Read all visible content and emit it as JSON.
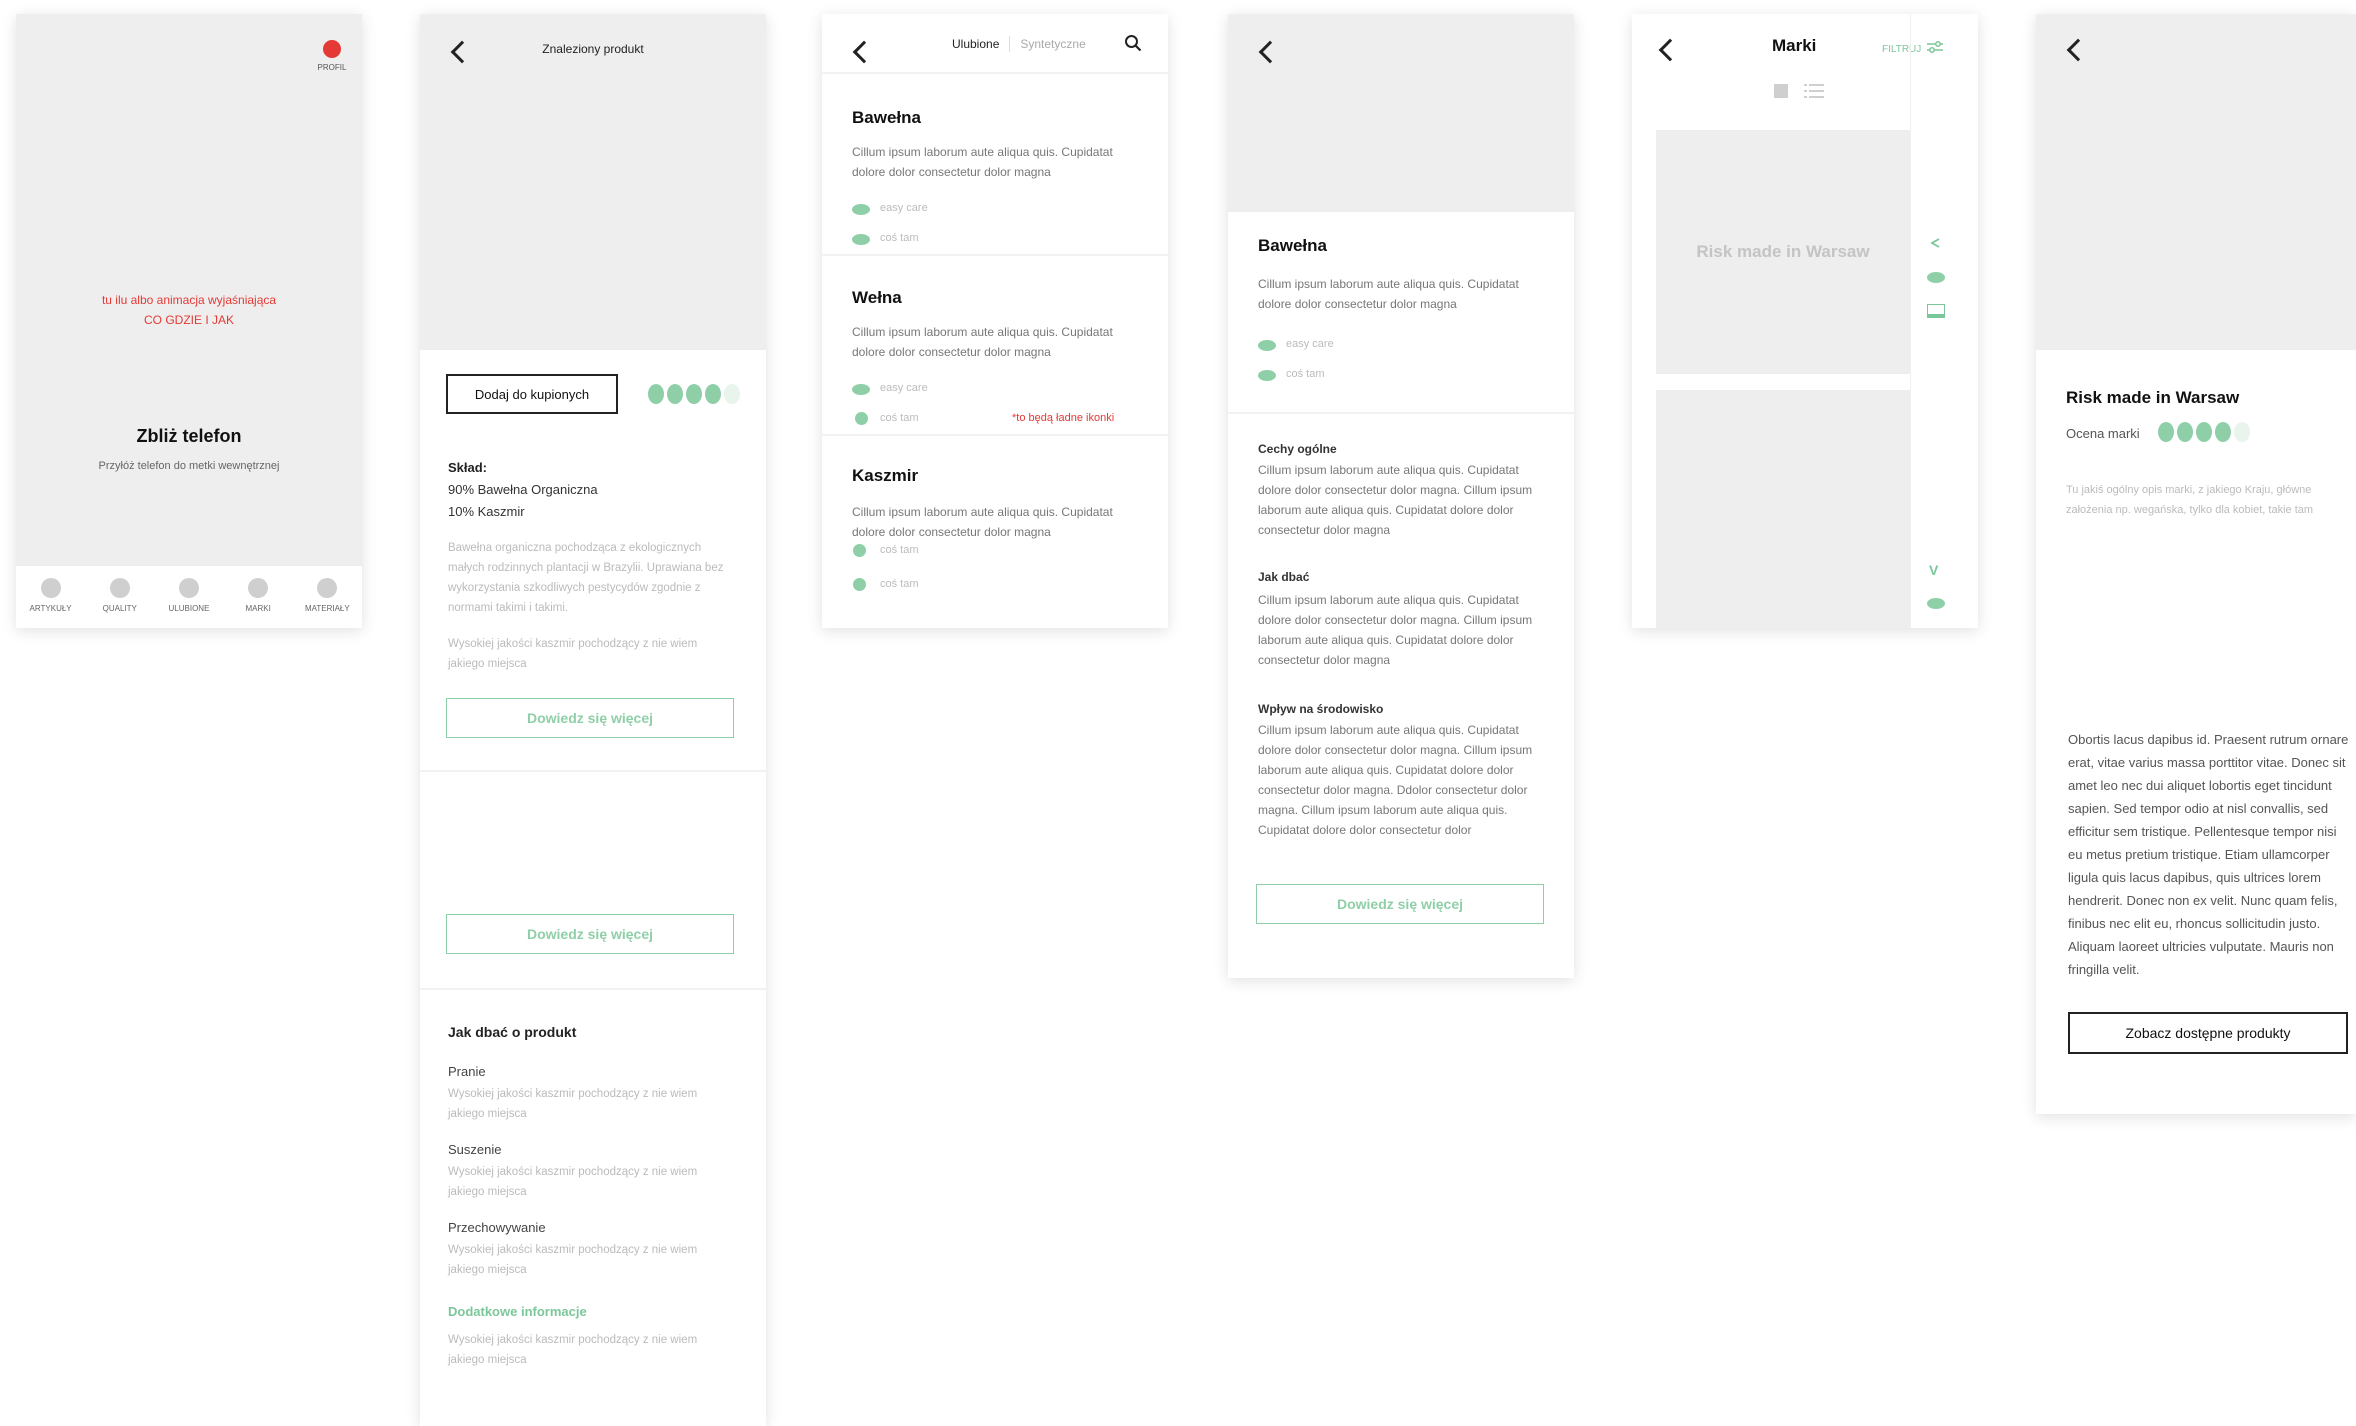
{
  "colors": {
    "accent": "#8fcfa8",
    "red": "#e53935",
    "placeholder": "#eeeeee"
  },
  "s1": {
    "profile_label": "PROFIL",
    "anim_note_1": "tu ilu albo animacja wyjaśniająca",
    "anim_note_2": "CO GDZIE I JAK",
    "title": "Zbliż telefon",
    "subtitle": "Przyłóż telefon do metki wewnętrznej",
    "nav": [
      "ARTYKUŁY",
      "QUALITY",
      "ULUBIONE",
      "MARKI",
      "MATERIAŁY"
    ]
  },
  "s2": {
    "title": "Znaleziony produkt",
    "add_button": "Dodaj do kupionych",
    "rating": 4,
    "sklad_label": "Skład:",
    "sklad_1": "90% Bawełna Organiczna",
    "sklad_2": "10% Kaszmir",
    "desc1": "Bawełna organiczna pochodząca z ekologicznych małych rodzinnych plantacji w Brazylii. Uprawiana bez wykorzystania szkodliwych pestycydów zgodnie z normami takimi i takimi.",
    "desc2": "Wysokiej jakości kaszmir pochodzący z nie wiem jakiego miejsca",
    "more_1": "Dowiedz się więcej",
    "more_2": "Dowiedz się więcej",
    "care_title": "Jak dbać o produkt",
    "care": [
      {
        "title": "Pranie",
        "text": "Wysokiej jakości kaszmir pochodzący z nie wiem jakiego miejsca"
      },
      {
        "title": "Suszenie",
        "text": "Wysokiej jakości kaszmir pochodzący z nie wiem jakiego miejsca"
      },
      {
        "title": "Przechowywanie",
        "text": "Wysokiej jakości kaszmir pochodzący z nie wiem jakiego miejsca"
      }
    ],
    "extra_title": "Dodatkowe informacje",
    "extra_text": "Wysokiej jakości kaszmir pochodzący z nie wiem jakiego miejsca"
  },
  "s3": {
    "tab_active": "Ulubione",
    "tab_inactive": "Syntetyczne",
    "items": [
      {
        "name": "Bawełna",
        "desc": "Cillum ipsum laborum aute aliqua quis. Cupidatat dolore dolor consectetur dolor magna",
        "tag1": "easy care",
        "tag2": "coś tam"
      },
      {
        "name": "Wełna",
        "desc": "Cillum ipsum laborum aute aliqua quis. Cupidatat dolore dolor consectetur dolor magna",
        "tag1": "easy care",
        "tag2": "coś tam",
        "note": "*to będą ładne ikonki"
      },
      {
        "name": "Kaszmir",
        "desc": "Cillum ipsum laborum aute aliqua quis. Cupidatat dolore dolor consectetur dolor magna",
        "tag1": "coś tam",
        "tag2": "coś tam"
      }
    ]
  },
  "s4": {
    "title": "Bawełna",
    "desc": "Cillum ipsum laborum aute aliqua quis. Cupidatat dolore dolor consectetur dolor magna",
    "tag1": "easy care",
    "tag2": "coś tam",
    "sections": [
      {
        "title": "Cechy ogólne",
        "text": "Cillum ipsum laborum aute aliqua quis. Cupidatat dolore dolor consectetur dolor magna. Cillum ipsum laborum aute aliqua quis. Cupidatat dolore dolor consectetur dolor magna"
      },
      {
        "title": "Jak dbać",
        "text": "Cillum ipsum laborum aute aliqua quis. Cupidatat dolore dolor consectetur dolor magna. Cillum ipsum laborum aute aliqua quis. Cupidatat dolore dolor consectetur dolor magna"
      },
      {
        "title": "Wpływ na środowisko",
        "text": "Cillum ipsum laborum aute aliqua quis. Cupidatat dolore dolor consectetur dolor magna. Cillum ipsum laborum aute aliqua quis. Cupidatat dolore dolor consectetur dolor magna. Ddolor consectetur dolor magna. Cillum ipsum laborum aute aliqua quis. Cupidatat dolore dolor consectetur dolor"
      }
    ],
    "more": "Dowiedz się więcej"
  },
  "s5": {
    "title": "Marki",
    "filter": "FILTRUJ",
    "brand_card": "Risk made in Warsaw",
    "side_letter": "V"
  },
  "s6": {
    "brand": "Risk made in Warsaw",
    "rating_label": "Ocena marki",
    "rating": 4,
    "intro": "Tu jakiś ogólny opis marki, z jakiego Kraju, główne założenia np. wegańska, tylko dla kobiet, takie tam",
    "body": "Obortis lacus dapibus id. Praesent rutrum ornare erat, vitae varius massa porttitor vitae. Donec sit amet leo nec dui aliquet lobortis eget tincidunt sapien. Sed tempor odio at nisl convallis, sed efficitur sem tristique. Pellentesque tempor nisi eu metus pretium tristique. Etiam ullamcorper ligula quis lacus dapibus, quis ultrices lorem hendrerit. Donec non ex velit. Nunc quam felis, finibus nec elit eu, rhoncus sollicitudin justo. Aliquam laoreet ultricies vulputate. Mauris non fringilla velit.",
    "cta": "Zobacz dostępne produkty"
  }
}
